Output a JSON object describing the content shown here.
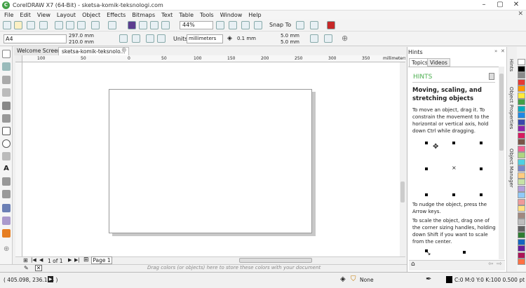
{
  "window": {
    "title": "CorelDRAW X7 (64-Bit) - sketsa-komik-teksnologi.com"
  },
  "menu": [
    "File",
    "Edit",
    "View",
    "Layout",
    "Object",
    "Effects",
    "Bitmaps",
    "Text",
    "Table",
    "Tools",
    "Window",
    "Help"
  ],
  "toolbar": {
    "zoom": "44%",
    "snap_to": "Snap To"
  },
  "properties": {
    "page_size": "A4",
    "width": "297.0 mm",
    "height": "210.0 mm",
    "units_label": "Units:",
    "units": "millimeters",
    "nudge": "0.1 mm",
    "dup_x": "5.0 mm",
    "dup_y": "5.0 mm"
  },
  "tabs": [
    {
      "label": "Welcome Screen"
    },
    {
      "label": "sketsa-komik-teksnolo..."
    }
  ],
  "ruler": {
    "ticks": [
      "100",
      "50",
      "0",
      "50",
      "100",
      "150",
      "200",
      "250",
      "300",
      "350"
    ],
    "unit_label": "millimeters"
  },
  "pages": {
    "counter": "1 of 1",
    "tab": "Page 1"
  },
  "drag_hint": "Drag colors (or objects) here to store these colors with your document",
  "status": {
    "cursor": "( 405.098, 236.124 )",
    "fill": "None",
    "outline": "C:0 M:0 Y:0 K:100  0.500 pt"
  },
  "docker": {
    "title": "Hints",
    "tabs": [
      "Topics",
      "Videos"
    ],
    "header": "HINTS",
    "heading": "Moving, scaling, and stretching objects",
    "p1": "To move an object, drag it. To constrain the movement to the horizontal or vertical axis, hold down Ctrl while dragging.",
    "p2": "To nudge the object, press the Arrow keys.",
    "p3": "To scale the object, drag one of the corner sizing handles, holding down Shift if you want to scale from the center."
  },
  "side_tabs": [
    "Hints",
    "Object Properties",
    "Object Manager"
  ],
  "colors": {
    "accent": "#4caf50",
    "palette": [
      "#ffffff",
      "#000000",
      "#8a8a8a",
      "#e53935",
      "#ff9800",
      "#ffeb3b",
      "#43a047",
      "#00acc1",
      "#1e88e5",
      "#3949ab",
      "#8e24aa",
      "#d81b60",
      "#795548",
      "#f06292",
      "#aed581",
      "#4dd0e1",
      "#7986cb",
      "#ffcc80",
      "#c5e1a5",
      "#b39ddb",
      "#90caf9",
      "#ef9a9a",
      "#ffe082",
      "#a1887f",
      "#bdbdbd",
      "#616161",
      "#2e7d32",
      "#1565c0",
      "#6a1b9a",
      "#ad1457",
      "#ff7043"
    ]
  }
}
